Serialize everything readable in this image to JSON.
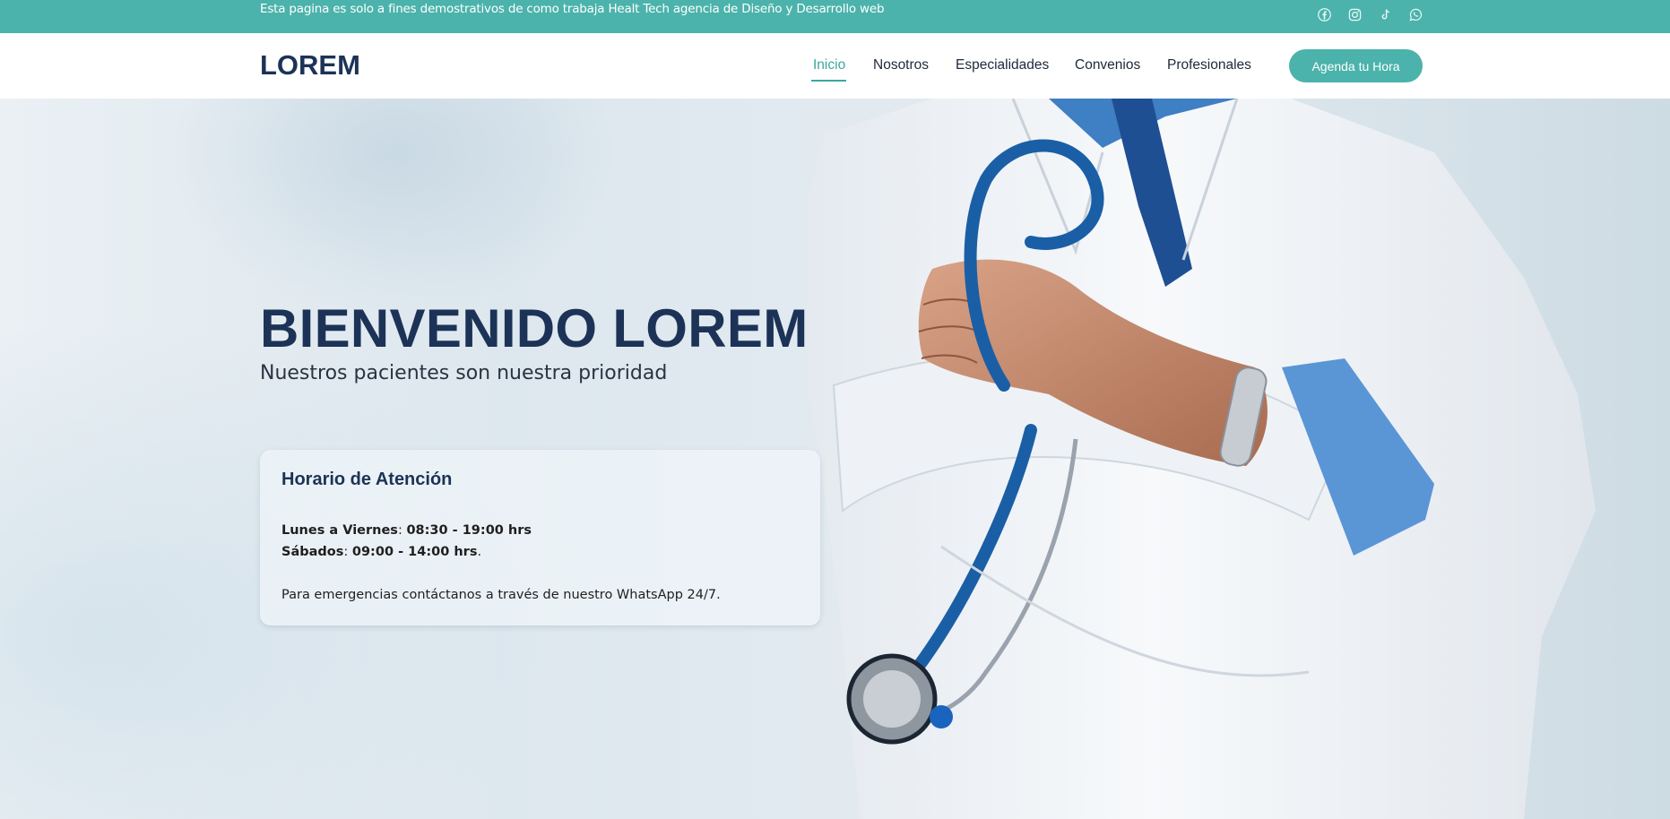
{
  "topbar": {
    "notice": "Esta pagina es solo a fines demostrativos de como trabaja Healt Tech agencia de Diseño y Desarrollo web",
    "social": [
      {
        "icon": "facebook-icon"
      },
      {
        "icon": "instagram-icon"
      },
      {
        "icon": "tiktok-icon"
      },
      {
        "icon": "whatsapp-icon"
      }
    ]
  },
  "navbar": {
    "logo": "LOREM",
    "items": [
      {
        "label": "Inicio",
        "active": true
      },
      {
        "label": "Nosotros"
      },
      {
        "label": "Especialidades"
      },
      {
        "label": "Convenios"
      },
      {
        "label": "Profesionales"
      }
    ],
    "cta_label": "Agenda tu Hora"
  },
  "hero": {
    "title": "BIENVENIDO LOREM",
    "subtitle": "Nuestros pacientes son nuestra prioridad",
    "image": "doctor-with-stethoscope-photo"
  },
  "schedule": {
    "title": "Horario de Atención",
    "weekdays_label": "Lunes a Viernes",
    "weekdays_hours": "08:30 - 19:00 hrs",
    "saturday_label": "Sábados",
    "saturday_hours": "09:00 - 14:00 hrs",
    "emergency_note": "Para emergencias contáctanos a través de nuestro WhatsApp 24/7."
  },
  "colors": {
    "accent": "#4bb3ab",
    "navy": "#1c3357"
  }
}
